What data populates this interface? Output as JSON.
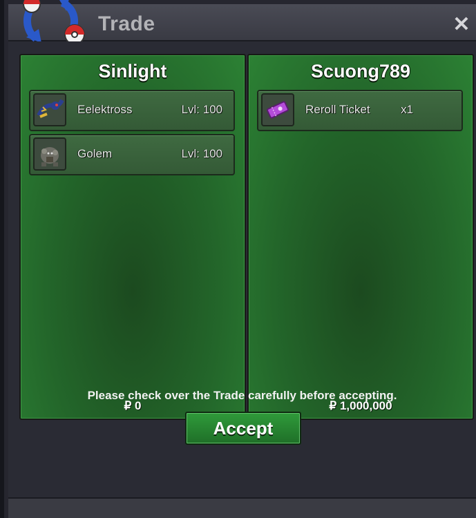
{
  "window": {
    "title": "Trade",
    "close_label": "✕"
  },
  "left_panel": {
    "player_name": "Sinlight",
    "items": [
      {
        "name": "Eelektross",
        "detail": "Lvl: 100",
        "icon": "eelektross-sprite-icon"
      },
      {
        "name": "Golem",
        "detail": "Lvl: 100",
        "icon": "golem-sprite-icon"
      }
    ],
    "money": "₽ 0"
  },
  "right_panel": {
    "player_name": "Scuong789",
    "items": [
      {
        "name": "Reroll Ticket",
        "detail": "x1",
        "icon": "ticket-icon"
      }
    ],
    "money": "₽ 1,000,000"
  },
  "notice": "Please check over the Trade carefully before accepting.",
  "accept_label": "Accept",
  "colors": {
    "panel_green": "#23662a",
    "accept_green": "#2f9a3a",
    "window_bg": "#2a2b34",
    "ticket_purple": "#b34cd9"
  }
}
